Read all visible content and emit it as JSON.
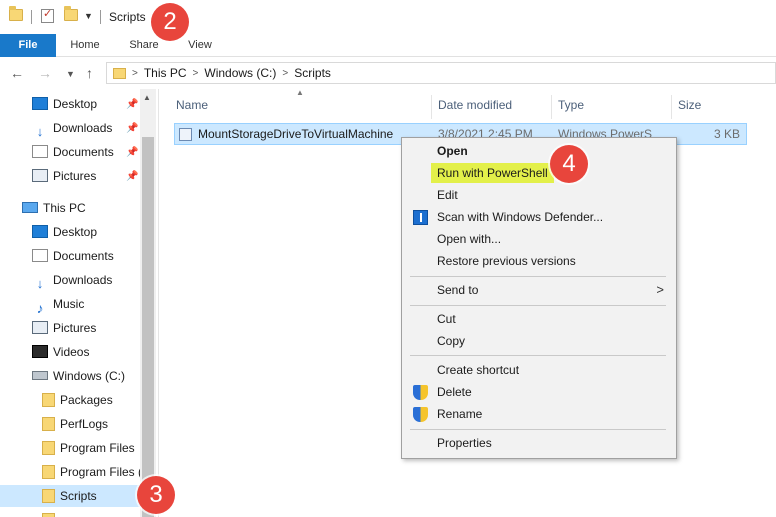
{
  "window": {
    "title": "Scripts"
  },
  "ribbon": {
    "tabs": [
      "File",
      "Home",
      "Share",
      "View"
    ]
  },
  "address": {
    "crumbs": [
      "This PC",
      "Windows (C:)",
      "Scripts"
    ]
  },
  "nav": {
    "quick_access": [
      {
        "label": "Desktop",
        "icon": "desktop-icon"
      },
      {
        "label": "Downloads",
        "icon": "download-icon"
      },
      {
        "label": "Documents",
        "icon": "documents-icon"
      },
      {
        "label": "Pictures",
        "icon": "pictures-icon"
      }
    ],
    "this_pc": "This PC",
    "pc_items": [
      {
        "label": "Desktop",
        "icon": "desktop-icon"
      },
      {
        "label": "Documents",
        "icon": "documents-icon"
      },
      {
        "label": "Downloads",
        "icon": "download-icon"
      },
      {
        "label": "Music",
        "icon": "music-icon"
      },
      {
        "label": "Pictures",
        "icon": "pictures-icon"
      },
      {
        "label": "Videos",
        "icon": "videos-icon"
      },
      {
        "label": "Windows (C:)",
        "icon": "drive-icon"
      }
    ],
    "drive_folders": [
      "Packages",
      "PerfLogs",
      "Program Files",
      "Program Files (",
      "Scripts"
    ],
    "selected": "Scripts"
  },
  "columns": {
    "name": "Name",
    "date": "Date modified",
    "type": "Type",
    "size": "Size"
  },
  "files": [
    {
      "name": "MountStorageDriveToVirtualMachine",
      "date": "3/8/2021 2:45 PM",
      "type": "Windows PowerS",
      "size": "3 KB"
    }
  ],
  "context_menu": {
    "open": "Open",
    "run_powershell": "Run with PowerShell",
    "edit": "Edit",
    "scan_defender": "Scan with Windows Defender...",
    "open_with": "Open with...",
    "restore": "Restore previous versions",
    "send_to": "Send to",
    "cut": "Cut",
    "copy": "Copy",
    "create_shortcut": "Create shortcut",
    "delete": "Delete",
    "rename": "Rename",
    "properties": "Properties"
  },
  "callouts": {
    "step2": "2",
    "step3": "3",
    "step4": "4"
  },
  "colors": {
    "accent": "#1979ca",
    "selection": "#cce8ff",
    "callout": "#e8453c",
    "highlight": "#e3f04a"
  }
}
